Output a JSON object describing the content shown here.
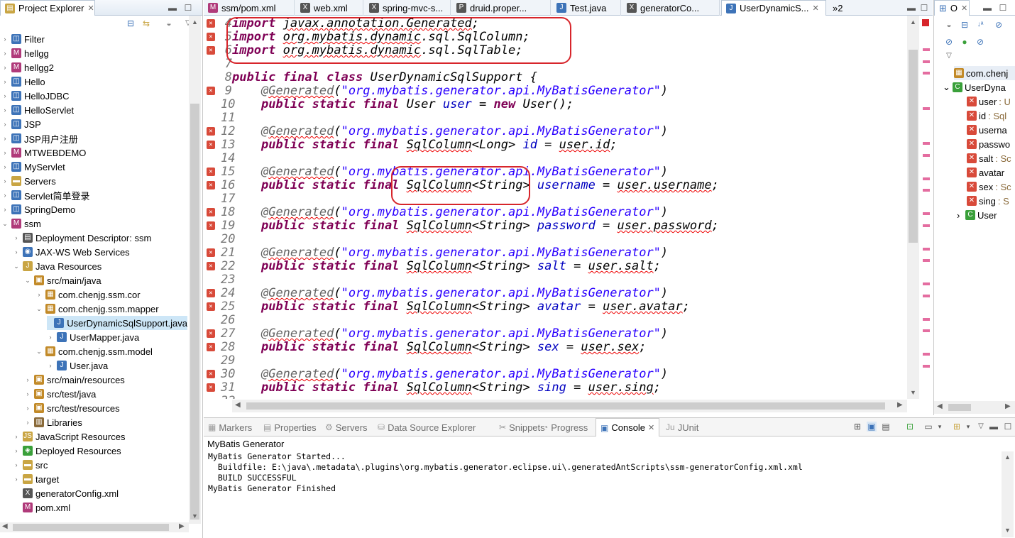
{
  "project_explorer": {
    "tab_label": "Project Explorer",
    "close_glyph": "✕",
    "items": [
      {
        "label": "Filter",
        "depth": 0,
        "icon": "web-project-icon",
        "expanded": false
      },
      {
        "label": "hellgg",
        "depth": 0,
        "icon": "maven-project-icon",
        "expanded": false
      },
      {
        "label": "hellgg2",
        "depth": 0,
        "icon": "maven-project-icon",
        "expanded": false
      },
      {
        "label": "Hello",
        "depth": 0,
        "icon": "web-project-icon",
        "expanded": false
      },
      {
        "label": "HelloJDBC",
        "depth": 0,
        "icon": "web-project-icon",
        "expanded": false
      },
      {
        "label": "HelloServlet",
        "depth": 0,
        "icon": "web-project-icon",
        "expanded": false
      },
      {
        "label": "JSP",
        "depth": 0,
        "icon": "web-project-icon",
        "expanded": false
      },
      {
        "label": "JSP用户注册",
        "depth": 0,
        "icon": "web-project-icon",
        "expanded": false
      },
      {
        "label": "MTWEBDEMO",
        "depth": 0,
        "icon": "maven-project-icon",
        "expanded": false
      },
      {
        "label": "MyServlet",
        "depth": 0,
        "icon": "web-project-icon",
        "expanded": false
      },
      {
        "label": "Servers",
        "depth": 0,
        "icon": "folder-icon",
        "expanded": false
      },
      {
        "label": "Servlet简单登录",
        "depth": 0,
        "icon": "web-project-icon",
        "expanded": false
      },
      {
        "label": "SpringDemo",
        "depth": 0,
        "icon": "web-project-icon",
        "expanded": false
      },
      {
        "label": "ssm",
        "depth": 0,
        "icon": "maven-project-icon",
        "expanded": true
      },
      {
        "label": "Deployment Descriptor: ssm",
        "depth": 1,
        "icon": "descriptor-icon",
        "expanded": false
      },
      {
        "label": "JAX-WS Web Services",
        "depth": 1,
        "icon": "webservice-icon",
        "expanded": false
      },
      {
        "label": "Java Resources",
        "depth": 1,
        "icon": "java-resources-icon",
        "expanded": true
      },
      {
        "label": "src/main/java",
        "depth": 2,
        "icon": "source-folder-icon",
        "expanded": true
      },
      {
        "label": "com.chenjg.ssm.cor",
        "depth": 3,
        "icon": "package-icon",
        "expanded": false
      },
      {
        "label": "com.chenjg.ssm.mapper",
        "depth": 3,
        "icon": "package-icon",
        "expanded": true
      },
      {
        "label": "UserDynamicSqlSupport.java",
        "depth": 4,
        "icon": "java-file-icon",
        "expanded": null,
        "selected": true
      },
      {
        "label": "UserMapper.java",
        "depth": 4,
        "icon": "java-file-icon",
        "expanded": false
      },
      {
        "label": "com.chenjg.ssm.model",
        "depth": 3,
        "icon": "package-icon",
        "expanded": true
      },
      {
        "label": "User.java",
        "depth": 4,
        "icon": "java-file-icon",
        "expanded": false
      },
      {
        "label": "src/main/resources",
        "depth": 2,
        "icon": "source-folder-icon",
        "expanded": false
      },
      {
        "label": "src/test/java",
        "depth": 2,
        "icon": "source-folder-icon",
        "expanded": false
      },
      {
        "label": "src/test/resources",
        "depth": 2,
        "icon": "source-folder-icon",
        "expanded": false
      },
      {
        "label": "Libraries",
        "depth": 2,
        "icon": "library-icon",
        "expanded": false
      },
      {
        "label": "JavaScript Resources",
        "depth": 1,
        "icon": "js-resources-icon",
        "expanded": false
      },
      {
        "label": "Deployed Resources",
        "depth": 1,
        "icon": "deployed-icon",
        "expanded": false
      },
      {
        "label": "src",
        "depth": 1,
        "icon": "folder-icon",
        "expanded": false
      },
      {
        "label": "target",
        "depth": 1,
        "icon": "folder-icon",
        "expanded": false
      },
      {
        "label": "generatorConfig.xml",
        "depth": 1,
        "icon": "xml-file-icon",
        "expanded": null
      },
      {
        "label": "pom.xml",
        "depth": 1,
        "icon": "maven-file-icon",
        "expanded": null
      }
    ]
  },
  "editor": {
    "tabs": [
      {
        "label": "ssm/pom.xml",
        "icon": "maven-file-icon"
      },
      {
        "label": "web.xml",
        "icon": "xml-file-icon"
      },
      {
        "label": "spring-mvc-s...",
        "icon": "xml-file-icon"
      },
      {
        "label": "druid.proper...",
        "icon": "properties-file-icon"
      },
      {
        "label": "Test.java",
        "icon": "java-file-icon"
      },
      {
        "label": "generatorCo...",
        "icon": "xml-file-icon"
      },
      {
        "label": "UserDynamicS...",
        "icon": "java-file-icon",
        "active": true
      }
    ],
    "overflow_label": "»2",
    "lines": [
      {
        "n": "4",
        "err": true,
        "html": "<span class='kw'>import</span> <span class='ul'>javax.annotation.Generated</span>;"
      },
      {
        "n": "5",
        "err": true,
        "html": "<span class='kw'>import</span> <span class='ul'>org.mybatis.dynamic</span>.sql.SqlColumn;"
      },
      {
        "n": "6",
        "err": true,
        "html": "<span class='kw'>import</span> <span class='ul'>org.mybatis.dynamic</span>.sql.SqlTable;"
      },
      {
        "n": "7",
        "err": false,
        "html": ""
      },
      {
        "n": "8",
        "err": false,
        "html": "<span class='kw'>public final class</span> UserDynamicSqlSupport {"
      },
      {
        "n": "9",
        "err": true,
        "html": "    <span class='an'>@<span class='ul'>Generated</span></span>(<span class='st'>\"org.mybatis.generator.api.MyBatisGenerator\"</span>)"
      },
      {
        "n": "10",
        "err": false,
        "html": "    <span class='kw'>public static final</span> User <span class='fd'>user</span> = <span class='kw'>new</span> User();"
      },
      {
        "n": "11",
        "err": false,
        "html": ""
      },
      {
        "n": "12",
        "err": true,
        "html": "    <span class='an'>@<span class='ul'>Generated</span></span>(<span class='st'>\"org.mybatis.generator.api.MyBatisGenerator\"</span>)"
      },
      {
        "n": "13",
        "err": true,
        "html": "    <span class='kw'>public static final</span> <span class='ul'>SqlColumn</span>&lt;Long&gt; <span class='fd'>id</span> = <span class='ul'>user.id</span>;"
      },
      {
        "n": "14",
        "err": false,
        "html": ""
      },
      {
        "n": "15",
        "err": true,
        "html": "    <span class='an'>@<span class='ul'>Generated</span></span>(<span class='st'>\"org.mybatis.generator.api.MyBatisGenerator\"</span>)"
      },
      {
        "n": "16",
        "err": true,
        "html": "    <span class='kw'>public static final</span> <span class='ul'>SqlColumn</span>&lt;String&gt; <span class='fd'>username</span> = <span class='ul'>user.username</span>;"
      },
      {
        "n": "17",
        "err": false,
        "html": ""
      },
      {
        "n": "18",
        "err": true,
        "html": "    <span class='an'>@<span class='ul'>Generated</span></span>(<span class='st'>\"org.mybatis.generator.api.MyBatisGenerator\"</span>)"
      },
      {
        "n": "19",
        "err": true,
        "html": "    <span class='kw'>public static final</span> <span class='ul'>SqlColumn</span>&lt;String&gt; <span class='fd'>password</span> = <span class='ul'>user.password</span>;"
      },
      {
        "n": "20",
        "err": false,
        "html": ""
      },
      {
        "n": "21",
        "err": true,
        "html": "    <span class='an'>@<span class='ul'>Generated</span></span>(<span class='st'>\"org.mybatis.generator.api.MyBatisGenerator\"</span>)"
      },
      {
        "n": "22",
        "err": true,
        "html": "    <span class='kw'>public static final</span> <span class='ul'>SqlColumn</span>&lt;String&gt; <span class='fd'>salt</span> = <span class='ul'>user.salt</span>;"
      },
      {
        "n": "23",
        "err": false,
        "html": ""
      },
      {
        "n": "24",
        "err": true,
        "html": "    <span class='an'>@<span class='ul'>Generated</span></span>(<span class='st'>\"org.mybatis.generator.api.MyBatisGenerator\"</span>)"
      },
      {
        "n": "25",
        "err": true,
        "html": "    <span class='kw'>public static final</span> <span class='ul'>SqlColumn</span>&lt;String&gt; <span class='fd'>avatar</span> = <span class='ul'>user.avatar</span>;"
      },
      {
        "n": "26",
        "err": false,
        "html": ""
      },
      {
        "n": "27",
        "err": true,
        "html": "    <span class='an'>@<span class='ul'>Generated</span></span>(<span class='st'>\"org.mybatis.generator.api.MyBatisGenerator\"</span>)"
      },
      {
        "n": "28",
        "err": true,
        "html": "    <span class='kw'>public static final</span> <span class='ul'>SqlColumn</span>&lt;String&gt; <span class='fd'>sex</span> = <span class='ul'>user.sex</span>;"
      },
      {
        "n": "29",
        "err": false,
        "html": ""
      },
      {
        "n": "30",
        "err": true,
        "html": "    <span class='an'>@<span class='ul'>Generated</span></span>(<span class='st'>\"org.mybatis.generator.api.MyBatisGenerator\"</span>)"
      },
      {
        "n": "31",
        "err": true,
        "html": "    <span class='kw'>public static final</span> <span class='ul'>SqlColumn</span>&lt;String&gt; <span class='fd'>sing</span> = <span class='ul'>user.sing</span>;"
      },
      {
        "n": "32",
        "err": false,
        "html": ""
      }
    ]
  },
  "outline": {
    "tab_label": "O",
    "tab_prefix": "⊞",
    "package_label": "com.chenj",
    "class_label": "UserDyna",
    "fields": [
      {
        "name": "user",
        "type": " : U"
      },
      {
        "name": "id",
        "type": " : Sql"
      },
      {
        "name": "userna",
        "type": ""
      },
      {
        "name": "passwo",
        "type": ""
      },
      {
        "name": "salt",
        "type": " : Sc"
      },
      {
        "name": "avatar",
        "type": ""
      },
      {
        "name": "sex",
        "type": " : Sc"
      },
      {
        "name": "sing",
        "type": " : S"
      }
    ],
    "inner_class_label": "User"
  },
  "console": {
    "tabs": [
      {
        "label": "Markers",
        "icon": "markers-icon"
      },
      {
        "label": "Properties",
        "icon": "properties-icon"
      },
      {
        "label": "Servers",
        "icon": "servers-icon"
      },
      {
        "label": "Data Source Explorer",
        "icon": "data-source-icon"
      },
      {
        "label": "Snippets",
        "icon": "snippets-icon"
      },
      {
        "label": "Progress",
        "icon": "progress-icon"
      },
      {
        "label": "Console",
        "icon": "console-icon",
        "active": true
      },
      {
        "label": "JUnit",
        "icon": "junit-icon"
      }
    ],
    "title": "MyBatis Generator",
    "output": [
      "MyBatis Generator Started...",
      "  Buildfile: E:\\java\\.metadata\\.plugins\\org.mybatis.generator.eclipse.ui\\.generatedAntScripts\\ssm-generatorConfig.xml.xml",
      "  BUILD SUCCESSFUL",
      "MyBatis Generator Finished"
    ]
  },
  "colors": {
    "keyword": "#7f0055",
    "string": "#2a00ff",
    "field": "#0000c0",
    "error": "#d7252b",
    "selection": "#cde6f7"
  }
}
